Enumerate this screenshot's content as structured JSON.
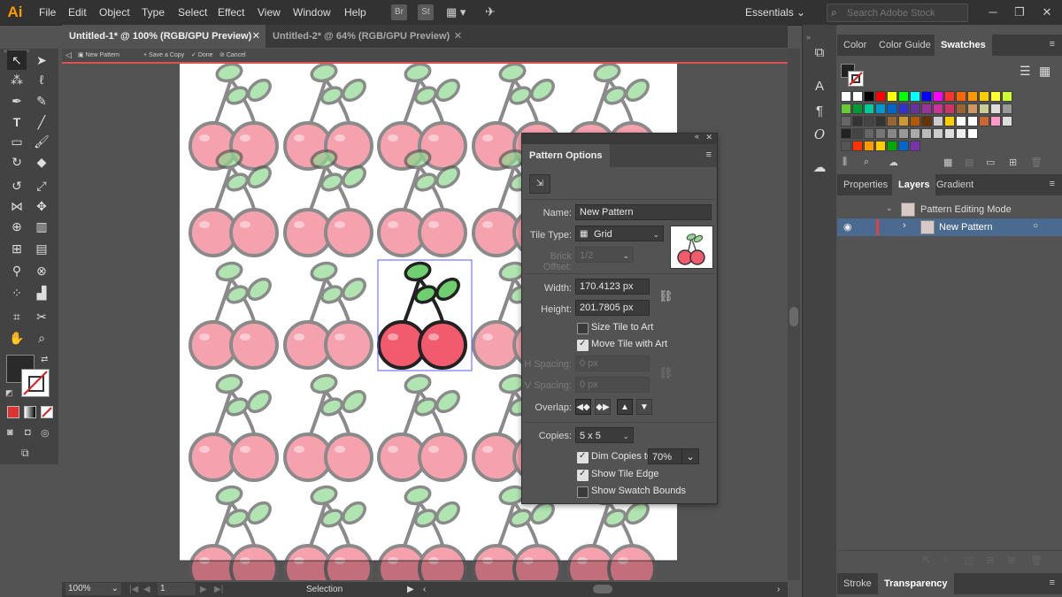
{
  "app": {
    "logo": "Ai",
    "accent": "#ff9a00"
  },
  "menu": [
    "File",
    "Edit",
    "Object",
    "Type",
    "Select",
    "Effect",
    "View",
    "Window",
    "Help"
  ],
  "menubar_icons": [
    "Br",
    "St"
  ],
  "workspace": "Essentials",
  "search": {
    "placeholder": "Search Adobe Stock"
  },
  "doc_tabs": [
    {
      "label": "Untitled-1* @ 100% (RGB/GPU Preview)",
      "active": true
    },
    {
      "label": "Untitled-2* @ 64% (RGB/GPU Preview)",
      "active": false
    }
  ],
  "pattern_bar": {
    "mode": "New Pattern",
    "save_copy": "Save a Copy",
    "done": "Done",
    "cancel": "Cancel"
  },
  "status": {
    "zoom": "100%",
    "page": "1",
    "tool": "Selection"
  },
  "pattern_options": {
    "title": "Pattern Options",
    "name_label": "Name:",
    "name_value": "New Pattern",
    "tile_type_label": "Tile Type:",
    "tile_type_value": "Grid",
    "brick_offset_label": "Brick Offset:",
    "brick_offset_value": "1/2",
    "width_label": "Width:",
    "width_value": "170.4123 px",
    "height_label": "Height:",
    "height_value": "201.7805 px",
    "size_tile_to_art": "Size Tile to Art",
    "size_tile_to_art_checked": false,
    "move_tile_with_art": "Move Tile with Art",
    "move_tile_with_art_checked": true,
    "h_spacing_label": "H Spacing:",
    "h_spacing_value": "0 px",
    "v_spacing_label": "V Spacing:",
    "v_spacing_value": "0 px",
    "overlap_label": "Overlap:",
    "copies_label": "Copies:",
    "copies_value": "5 x 5",
    "dim_copies_label": "Dim Copies to:",
    "dim_copies_checked": true,
    "dim_copies_value": "70%",
    "show_tile_edge": "Show Tile Edge",
    "show_tile_edge_checked": true,
    "show_swatch_bounds": "Show Swatch Bounds",
    "show_swatch_bounds_checked": false
  },
  "swatch_panel": {
    "tabs": [
      "Color",
      "Color Guide",
      "Swatches"
    ],
    "active": "Swatches"
  },
  "layers_panel": {
    "tabs": [
      "Properties",
      "Layers",
      "Gradient"
    ],
    "active": "Layers",
    "rows": [
      {
        "label": "Pattern Editing Mode"
      },
      {
        "label": "New Pattern"
      }
    ]
  },
  "bottom_panel": {
    "tabs": [
      "Stroke",
      "Transparency"
    ],
    "active": "Transparency"
  },
  "colors": {
    "cherry": "#f27b8c",
    "cherry_dark": "#5a5a5a",
    "leaf": "#8fd98f",
    "highlight_border": "#5a5aff",
    "layer_selected": "#4a6a8f"
  }
}
